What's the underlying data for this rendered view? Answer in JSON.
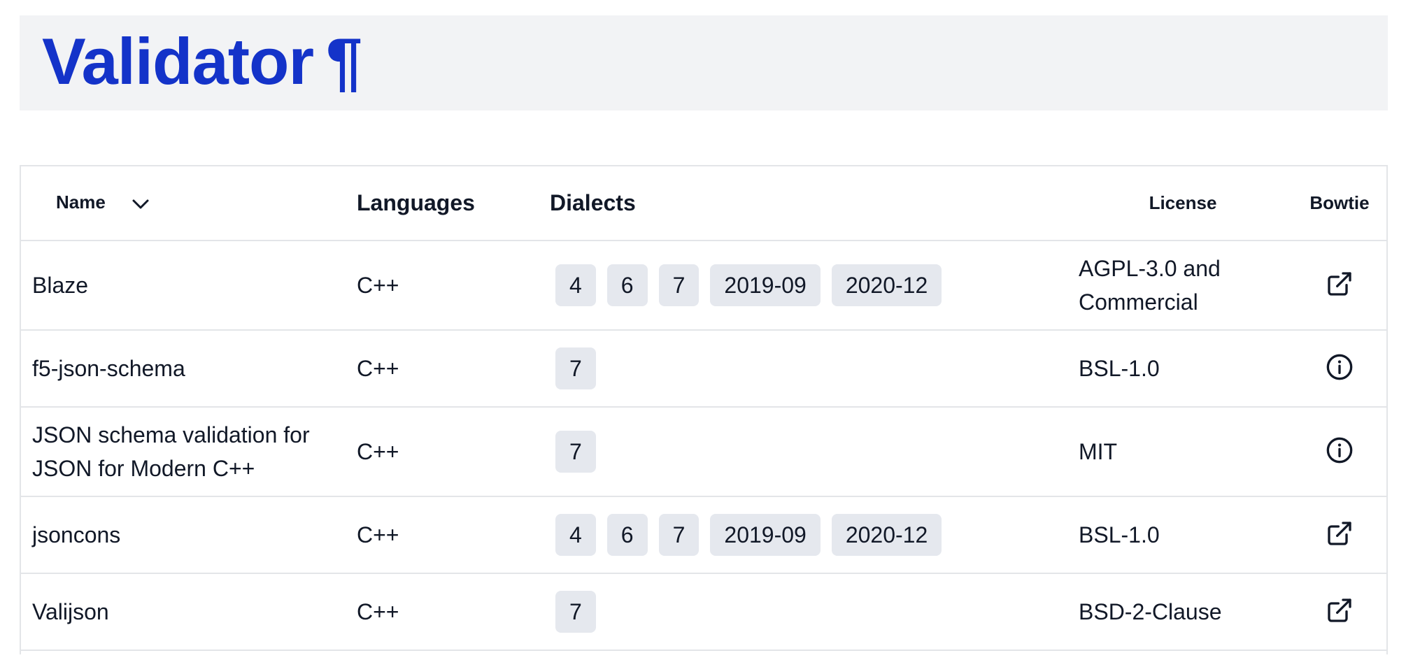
{
  "page": {
    "title": "Validator",
    "anchor": "¶"
  },
  "table": {
    "headers": {
      "name": "Name",
      "languages": "Languages",
      "dialects": "Dialects",
      "license": "License",
      "bowtie": "Bowtie"
    },
    "sort_icon": "chevron-down-icon",
    "rows": [
      {
        "name": "Blaze",
        "language": "C++",
        "dialects": [
          "4",
          "6",
          "7",
          "2019-09",
          "2020-12"
        ],
        "license": "AGPL-3.0 and Commercial",
        "bowtie_icon": "external-link-icon"
      },
      {
        "name": "f5-json-schema",
        "language": "C++",
        "dialects": [
          "7"
        ],
        "license": "BSL-1.0",
        "bowtie_icon": "info-icon"
      },
      {
        "name": "JSON schema validation for JSON for Modern C++",
        "language": "C++",
        "dialects": [
          "7"
        ],
        "license": "MIT",
        "bowtie_icon": "info-icon"
      },
      {
        "name": "jsoncons",
        "language": "C++",
        "dialects": [
          "4",
          "6",
          "7",
          "2019-09",
          "2020-12"
        ],
        "license": "BSL-1.0",
        "bowtie_icon": "external-link-icon"
      },
      {
        "name": "Valijson",
        "language": "C++",
        "dialects": [
          "7"
        ],
        "license": "BSD-2-Clause",
        "bowtie_icon": "external-link-icon"
      }
    ]
  },
  "colors": {
    "title": "#1433c9",
    "header_band": "#f2f3f5",
    "badge": "#e5e8ee",
    "border": "#e3e5e8"
  }
}
